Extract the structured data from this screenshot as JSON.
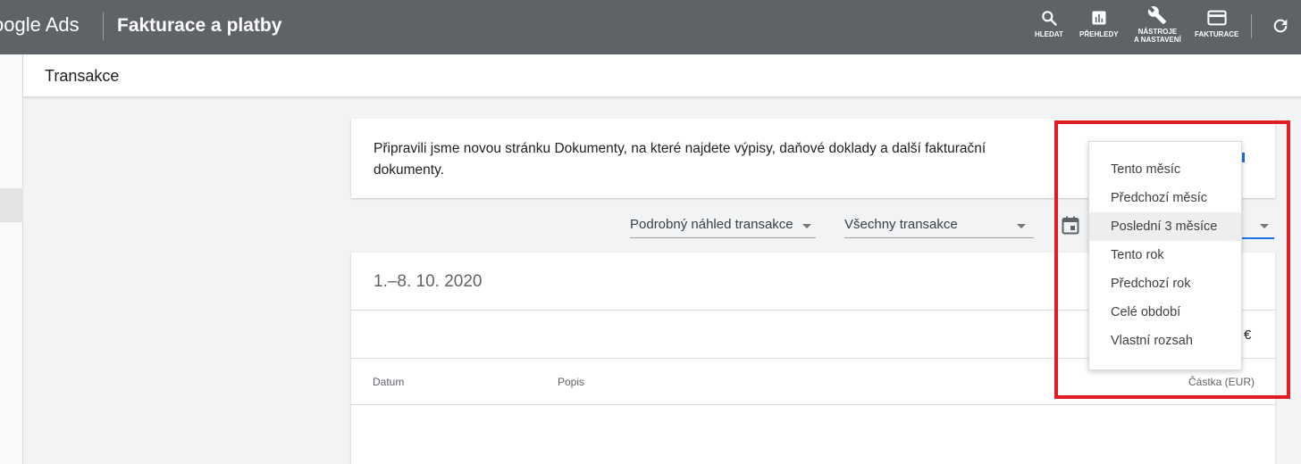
{
  "topbar": {
    "brand": "oogle Ads",
    "title": "Fakturace a platby",
    "tools": [
      {
        "icon": "search-icon",
        "label": "HLEDAT"
      },
      {
        "icon": "bar-chart-icon",
        "label": "PŘEHLEDY"
      },
      {
        "icon": "wrench-icon",
        "label_line1": "NÁSTROJE",
        "label_line2": "A NASTAVENÍ"
      },
      {
        "icon": "credit-card-icon",
        "label": "FAKTURACE"
      }
    ],
    "refresh_icon": "refresh-icon"
  },
  "subheader": {
    "title": "Transakce"
  },
  "notice": {
    "text": "Připravili jsme novou stránku Dokumenty, na které najdete výpisy, daňové doklady a další fakturační dokumenty."
  },
  "filters": {
    "view": "Podrobný náhled transakce",
    "type": "Všechny transakce",
    "calendar_icon": "calendar-icon"
  },
  "date_menu": {
    "options": [
      "Tento měsíc",
      "Předchozí měsíc",
      "Poslední 3 měsíce",
      "Tento rok",
      "Předchozí rok",
      "Celé období",
      "Vlastní rozsah"
    ],
    "selected": "Poslední 3 měsíce"
  },
  "card": {
    "period": "1.–8. 10. 2020",
    "currency_symbol": "€",
    "columns": {
      "date": "Datum",
      "description": "Popis",
      "amount": "Částka (EUR)"
    }
  },
  "colors": {
    "topbar": "#5f6368",
    "accent": "#1a73e8",
    "highlight": "#e11d21"
  }
}
